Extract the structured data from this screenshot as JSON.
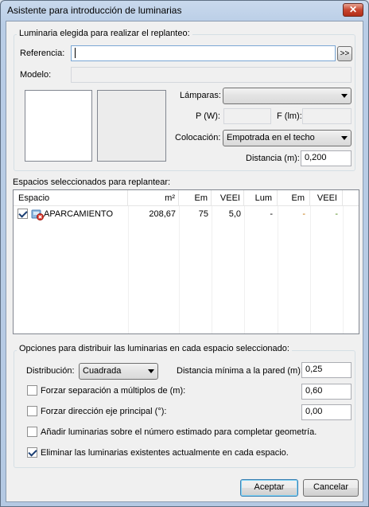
{
  "window": {
    "title": "Asistente para introducción de luminarias",
    "close_glyph": "✕"
  },
  "luminaria": {
    "group_title": "Luminaria elegida para realizar el replanteo:",
    "referencia_label": "Referencia:",
    "referencia_value": "",
    "browse_label": ">>",
    "modelo_label": "Modelo:",
    "modelo_value": "",
    "lamparas_label": "Lámparas:",
    "lamparas_value": "",
    "pw_label": "P (W):",
    "pw_value": "",
    "flm_label": "F (lm):",
    "flm_value": "",
    "colocacion_label": "Colocación:",
    "colocacion_value": "Empotrada en el techo",
    "distancia_label": "Distancia (m):",
    "distancia_value": "0,200"
  },
  "espacios": {
    "label": "Espacios seleccionados para replantear:",
    "columns": [
      "Espacio",
      "m²",
      "Em",
      "VEEI",
      "Lum",
      "Em",
      "VEEI"
    ],
    "rows": [
      {
        "checked": true,
        "icon": "space-error-icon",
        "name": "APARCAMIENTO",
        "m2": "208,67",
        "em": "75",
        "veei": "5,0",
        "lum": "-",
        "em2": "-",
        "veei2": "-"
      }
    ]
  },
  "opciones": {
    "group_title": "Opciones para distribuir las luminarias en cada espacio seleccionado:",
    "distribucion_label": "Distribución:",
    "distribucion_value": "Cuadrada",
    "distancia_min_label": "Distancia mínima a la pared (m):",
    "distancia_min_value": "0,25",
    "forzar_sep_label": "Forzar separación a múltiplos de (m):",
    "forzar_sep_value": "0,60",
    "forzar_sep_checked": false,
    "forzar_dir_label": "Forzar dirección eje principal (°):",
    "forzar_dir_value": "0,00",
    "forzar_dir_checked": false,
    "anadir_label": "Añadir luminarias sobre el número estimado para completar geometría.",
    "anadir_checked": false,
    "eliminar_label": "Eliminar las luminarias existentes actualmente en cada espacio.",
    "eliminar_checked": true
  },
  "buttons": {
    "aceptar": "Aceptar",
    "cancelar": "Cancelar"
  },
  "colors": {
    "accent": "#3c7fb1",
    "warning_dash": "#c07000",
    "ok_dash": "#4f8a1a"
  }
}
